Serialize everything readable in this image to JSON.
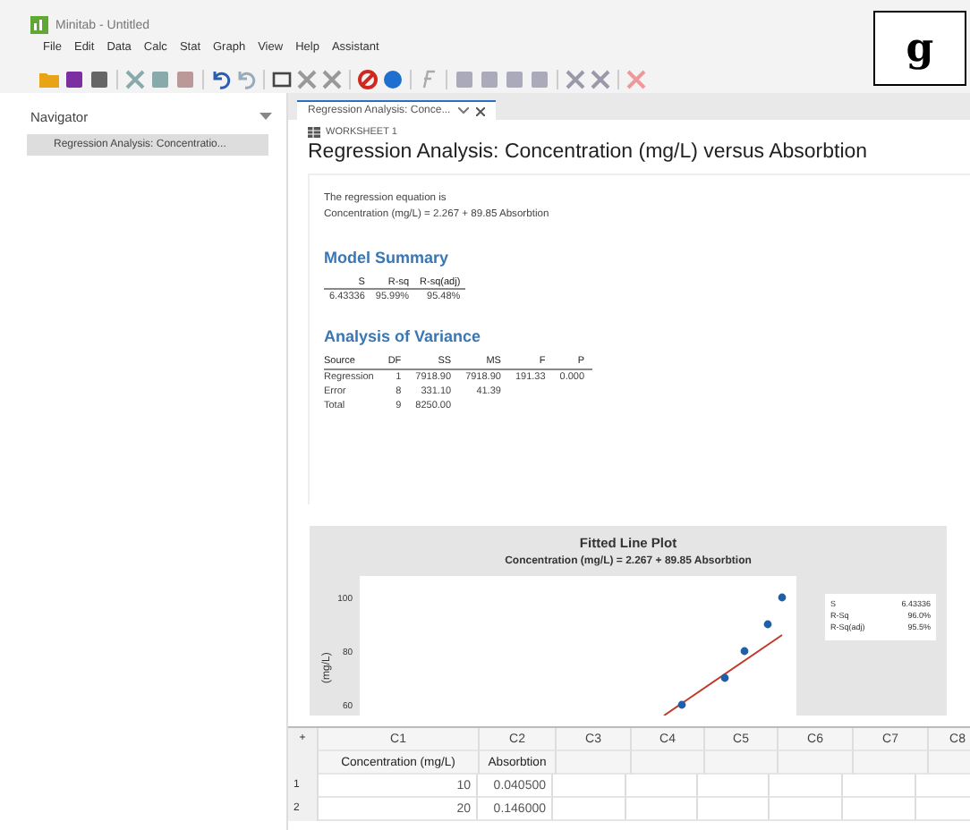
{
  "window": {
    "title": "Minitab - Untitled"
  },
  "corner_label": "g",
  "menu": [
    "File",
    "Edit",
    "Data",
    "Calc",
    "Stat",
    "Graph",
    "View",
    "Help",
    "Assistant"
  ],
  "navigator": {
    "title": "Navigator",
    "items": [
      {
        "label": "Regression Analysis: Concentratio...",
        "selected": true
      }
    ]
  },
  "tabs": [
    {
      "label": "Regression Analysis: Conce...",
      "selected": true
    }
  ],
  "output": {
    "worksheet": "WORKSHEET 1",
    "title": "Regression Analysis: Concentration (mg/L) versus Absorbtion",
    "equation_intro": "The regression equation is",
    "equation": "Concentration  (mg/L) = 2.267 + 89.85 Absorbtion",
    "model_summary": {
      "title": "Model Summary",
      "columns": [
        "S",
        "R-sq",
        "R-sq(adj)"
      ],
      "rows": [
        [
          "6.43336",
          "95.99%",
          "95.48%"
        ]
      ]
    },
    "anova": {
      "title": "Analysis of Variance",
      "columns": [
        "Source",
        "DF",
        "SS",
        "MS",
        "F",
        "P"
      ],
      "rows": [
        [
          "Regression",
          "1",
          "7918.90",
          "7918.90",
          "191.33",
          "0.000"
        ],
        [
          "Error",
          "8",
          "331.10",
          "41.39",
          "",
          ""
        ],
        [
          "Total",
          "9",
          "8250.00",
          "",
          "",
          " "
        ]
      ]
    },
    "plot": {
      "title": "Fitted Line Plot",
      "subtitle": "Concentration  (mg/L) = 2.267 + 89.85 Absorbtion",
      "y_axis_label": "(mg/L)",
      "y_ticks": [
        "100",
        "80",
        "60"
      ],
      "legend": [
        [
          "S",
          "6.43336"
        ],
        [
          "R-Sq",
          "96.0%"
        ],
        [
          "R-Sq(adj)",
          "95.5%"
        ]
      ]
    }
  },
  "worksheet": {
    "corner": "+",
    "columns": [
      "C1",
      "C2",
      "C3",
      "C4",
      "C5",
      "C6",
      "C7",
      "C8"
    ],
    "names": [
      "Concentration  (mg/L)",
      "Absorbtion"
    ],
    "rows": [
      {
        "number": "1",
        "cells": [
          "10",
          "0.040500"
        ]
      },
      {
        "number": "2",
        "cells": [
          "20",
          "0.146000"
        ]
      }
    ]
  }
}
